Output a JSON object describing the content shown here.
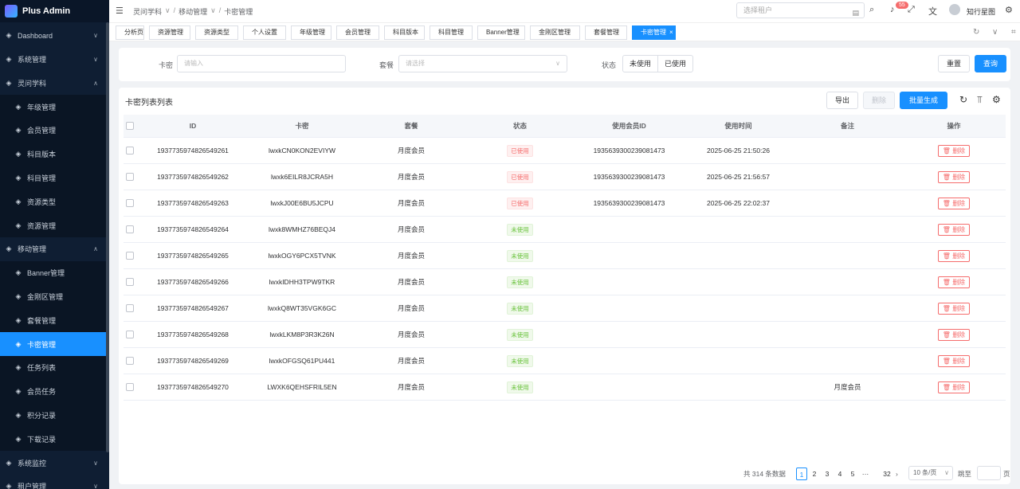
{
  "app": {
    "name": "Plus Admin"
  },
  "sidebar": {
    "items": [
      {
        "label": "Dashboard",
        "icon": "dashboard-icon",
        "chev": "∨"
      },
      {
        "label": "系统管理",
        "icon": "monitor-icon",
        "chev": "∨"
      },
      {
        "label": "灵问学科",
        "icon": "book-icon",
        "chev": "∧"
      },
      {
        "label": "年级管理",
        "icon": "grade-icon"
      },
      {
        "label": "会员管理",
        "icon": "member-icon"
      },
      {
        "label": "科目版本",
        "icon": "version-icon"
      },
      {
        "label": "科目管理",
        "icon": "subject-icon"
      },
      {
        "label": "资源类型",
        "icon": "link-icon"
      },
      {
        "label": "资源管理",
        "icon": "resource-icon"
      },
      {
        "label": "移动管理",
        "icon": "mobile-icon",
        "chev": "∧"
      },
      {
        "label": "Banner管理",
        "icon": "image-icon"
      },
      {
        "label": "金刚区管理",
        "icon": "grid-icon"
      },
      {
        "label": "套餐管理",
        "icon": "package-icon"
      },
      {
        "label": "卡密管理",
        "icon": "lock-icon"
      },
      {
        "label": "任务列表",
        "icon": "task-icon"
      },
      {
        "label": "会员任务",
        "icon": "member-task-icon"
      },
      {
        "label": "积分记录",
        "icon": "points-icon"
      },
      {
        "label": "下载记录",
        "icon": "download-icon"
      },
      {
        "label": "系统监控",
        "icon": "chart-icon",
        "chev": "∨"
      },
      {
        "label": "租户管理",
        "icon": "tenant-icon",
        "chev": "∨"
      }
    ]
  },
  "header": {
    "breadcrumb": [
      "灵问学科",
      "移动管理",
      "卡密管理"
    ],
    "tenant_placeholder": "选择租户",
    "notification_count": "55",
    "username": "知行星图"
  },
  "tabs": [
    "分析页",
    "资源管理",
    "资源类型",
    "个人设置",
    "年级管理",
    "会员管理",
    "科目版本",
    "科目管理",
    "Banner管理",
    "金刚区管理",
    "套餐管理",
    "卡密管理"
  ],
  "filter": {
    "card_label": "卡密",
    "card_placeholder": "请输入",
    "package_label": "套餐",
    "package_placeholder": "请选择",
    "status_label": "状态",
    "status_options": [
      "未使用",
      "已使用"
    ],
    "reset_label": "重置",
    "search_label": "查询"
  },
  "table": {
    "title": "卡密列表列表",
    "export_label": "导出",
    "delete_label": "删除",
    "batch_label": "批量生成",
    "columns": [
      "ID",
      "卡密",
      "套餐",
      "状态",
      "使用会员ID",
      "使用时间",
      "备注",
      "操作"
    ],
    "action_label": "删除",
    "rows": [
      {
        "id": "1937735974826549261",
        "code": "lwxkCN0KON2EVIYW",
        "package": "月度会员",
        "status": "已使用",
        "member": "1935639300239081473",
        "time": "2025-06-25 21:50:26",
        "note": ""
      },
      {
        "id": "1937735974826549262",
        "code": "lwxk6EILR8JCRA5H",
        "package": "月度会员",
        "status": "已使用",
        "member": "1935639300239081473",
        "time": "2025-06-25 21:56:57",
        "note": ""
      },
      {
        "id": "1937735974826549263",
        "code": "lwxkJ00E6BU5JCPU",
        "package": "月度会员",
        "status": "已使用",
        "member": "1935639300239081473",
        "time": "2025-06-25 22:02:37",
        "note": ""
      },
      {
        "id": "1937735974826549264",
        "code": "lwxk8WMHZ76BEQJ4",
        "package": "月度会员",
        "status": "未使用",
        "member": "",
        "time": "",
        "note": ""
      },
      {
        "id": "1937735974826549265",
        "code": "lwxkOGY6PCX5TVNK",
        "package": "月度会员",
        "status": "未使用",
        "member": "",
        "time": "",
        "note": ""
      },
      {
        "id": "1937735974826549266",
        "code": "lwxkIDHH3TPW9TKR",
        "package": "月度会员",
        "status": "未使用",
        "member": "",
        "time": "",
        "note": ""
      },
      {
        "id": "1937735974826549267",
        "code": "lwxkQ8WT35VGK6GC",
        "package": "月度会员",
        "status": "未使用",
        "member": "",
        "time": "",
        "note": ""
      },
      {
        "id": "1937735974826549268",
        "code": "lwxkLKM8P3R3K26N",
        "package": "月度会员",
        "status": "未使用",
        "member": "",
        "time": "",
        "note": ""
      },
      {
        "id": "1937735974826549269",
        "code": "lwxkOFGSQ61PU441",
        "package": "月度会员",
        "status": "未使用",
        "member": "",
        "time": "",
        "note": ""
      },
      {
        "id": "1937735974826549270",
        "code": "LWXK6QEHSFRIL5EN",
        "package": "月度会员",
        "status": "未使用",
        "member": "",
        "time": "",
        "note": "月度会员"
      }
    ]
  },
  "pagination": {
    "total_text": "共 314 条数据",
    "pages": [
      "1",
      "2",
      "3",
      "4",
      "5",
      "···",
      "32"
    ],
    "current": "1",
    "page_size": "10 条/页",
    "goto_label": "跳至",
    "page_suffix": "页"
  }
}
